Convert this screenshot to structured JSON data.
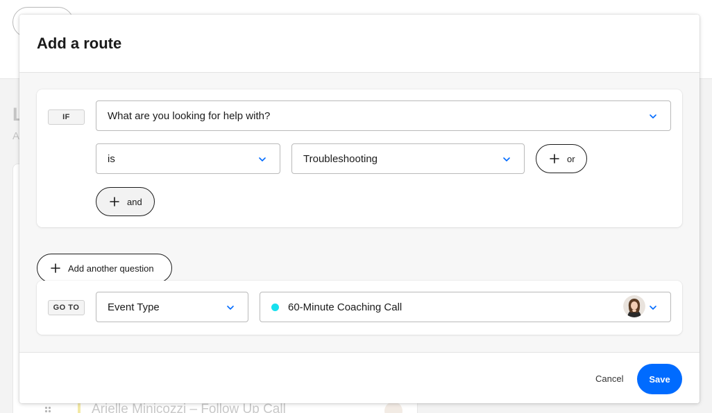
{
  "background": {
    "heading": "L",
    "subheading": "A",
    "row_title": "Arielle Minicozzi – Follow Up Call"
  },
  "modal": {
    "title": "Add a route",
    "if_tag": "IF",
    "question": "What are you looking for help with?",
    "operator": "is",
    "answer": "Troubleshooting",
    "or_label": "or",
    "and_label": "and",
    "add_question_label": "Add another question",
    "goto_tag": "GO TO",
    "destination_type": "Event Type",
    "event_name": "60-Minute Coaching Call",
    "cancel_label": "Cancel",
    "save_label": "Save"
  },
  "icons": {
    "chevron": "chevron-down-icon",
    "plus": "plus-icon",
    "event_color": "#17e0ee"
  },
  "colors": {
    "primary": "#006bff",
    "chevron": "#006bff"
  }
}
